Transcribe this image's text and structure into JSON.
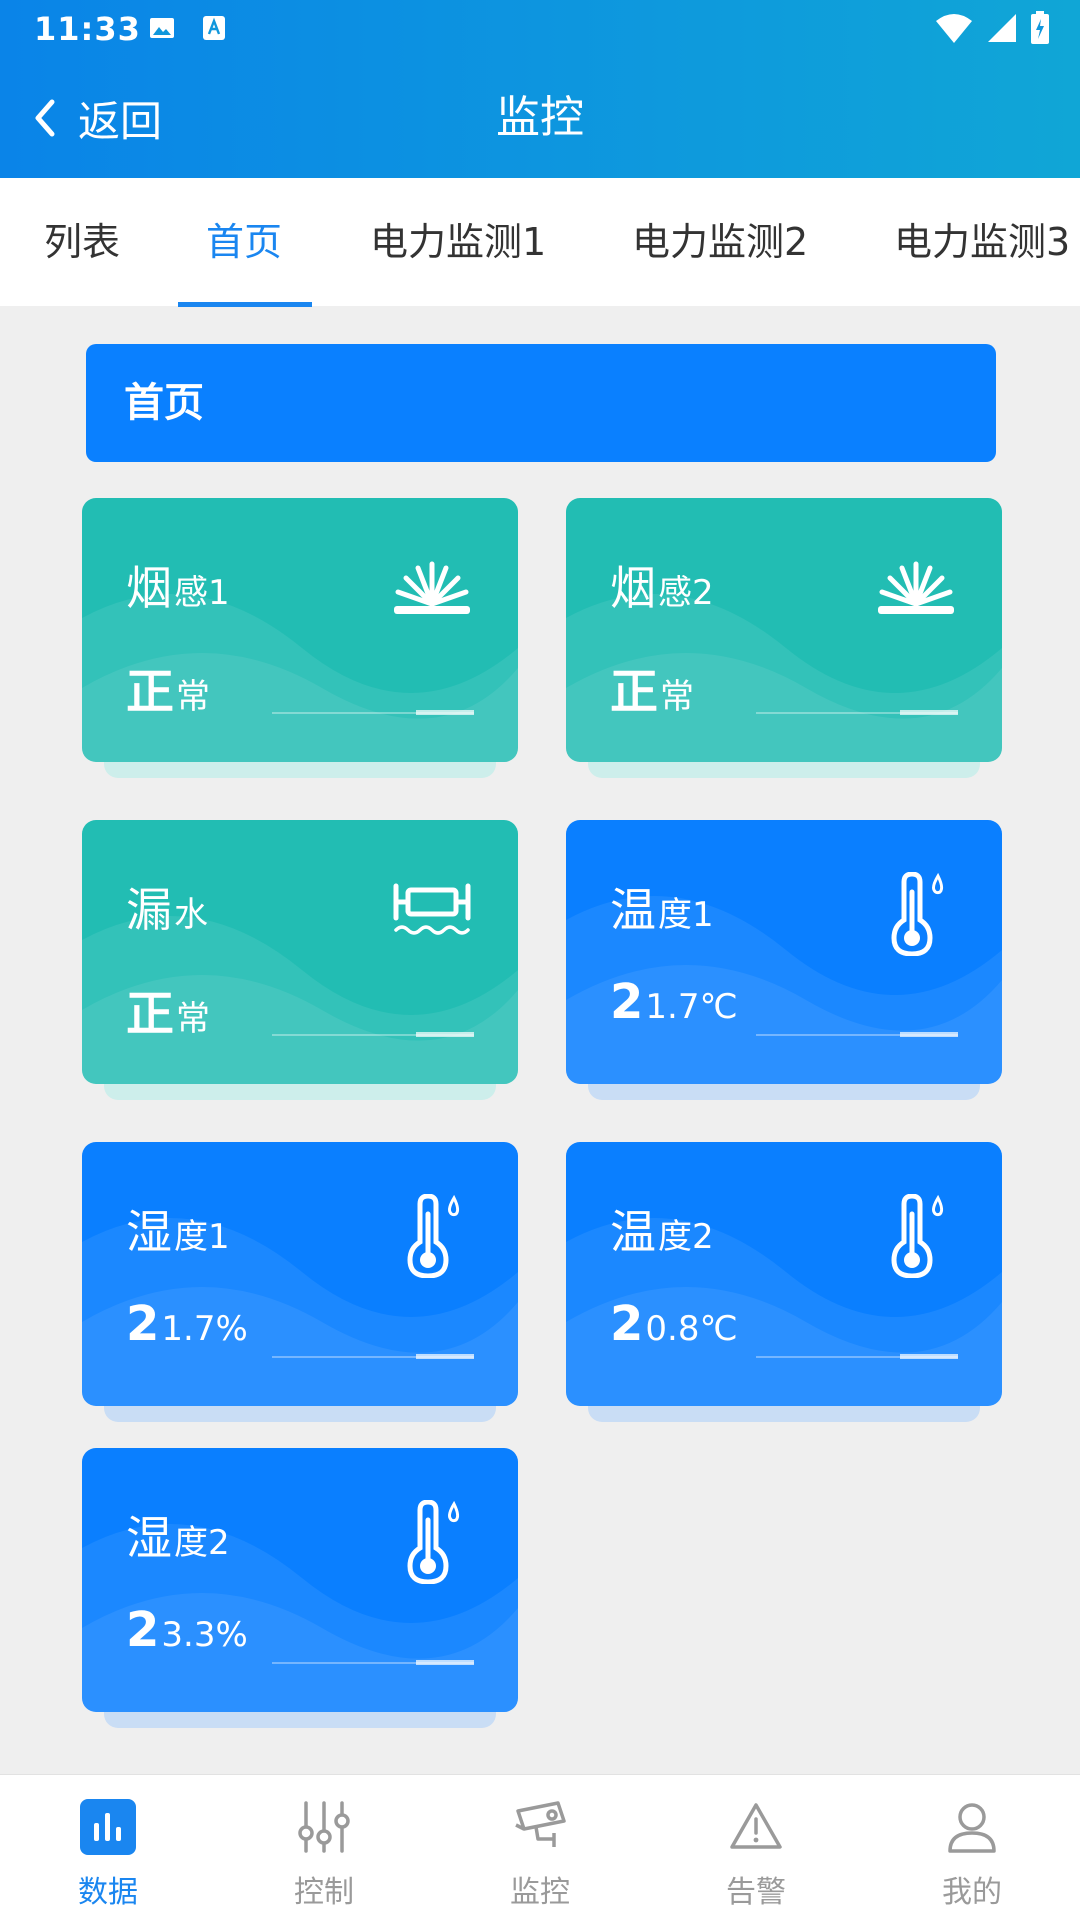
{
  "status_bar": {
    "time": "11:33"
  },
  "header": {
    "back_label": "返回",
    "title": "监控"
  },
  "tabs": [
    {
      "label": "列表",
      "active": false
    },
    {
      "label": "首页",
      "active": true
    },
    {
      "label": "电力监测1",
      "active": false
    },
    {
      "label": "电力监测2",
      "active": false
    },
    {
      "label": "电力监测3",
      "active": false
    }
  ],
  "section": {
    "title": "首页"
  },
  "cards": [
    {
      "name_big": "烟",
      "name_small": "感1",
      "value_big": "正",
      "value_small": "常",
      "icon": "smoke-sensor-icon",
      "color": "#22bdb3"
    },
    {
      "name_big": "烟",
      "name_small": "感2",
      "value_big": "正",
      "value_small": "常",
      "icon": "smoke-sensor-icon",
      "color": "#22bdb3"
    },
    {
      "name_big": "漏",
      "name_small": "水",
      "value_big": "正",
      "value_small": "常",
      "icon": "water-leak-icon",
      "color": "#22bdb3"
    },
    {
      "name_big": "温",
      "name_small": "度1",
      "value_big": "2",
      "value_small": "1.7℃",
      "icon": "thermometer-icon",
      "color": "#0a7fff"
    },
    {
      "name_big": "湿",
      "name_small": "度1",
      "value_big": "2",
      "value_small": "1.7%",
      "icon": "thermometer-icon",
      "color": "#0a7fff"
    },
    {
      "name_big": "温",
      "name_small": "度2",
      "value_big": "2",
      "value_small": "0.8℃",
      "icon": "thermometer-icon",
      "color": "#0a7fff"
    },
    {
      "name_big": "湿",
      "name_small": "度2",
      "value_big": "2",
      "value_small": "3.3%",
      "icon": "thermometer-icon",
      "color": "#0a7fff"
    }
  ],
  "bottom_nav": [
    {
      "label": "数据",
      "icon": "data-chart-icon",
      "active": true
    },
    {
      "label": "控制",
      "icon": "sliders-icon",
      "active": false
    },
    {
      "label": "监控",
      "icon": "camera-icon",
      "active": false
    },
    {
      "label": "告警",
      "icon": "warning-icon",
      "active": false
    },
    {
      "label": "我的",
      "icon": "user-icon",
      "active": false
    }
  ],
  "colors": {
    "primary": "#0a80ff",
    "teal": "#22bdb3",
    "active_tab": "#1a86f0",
    "nav_inactive": "#9a9a9a"
  }
}
